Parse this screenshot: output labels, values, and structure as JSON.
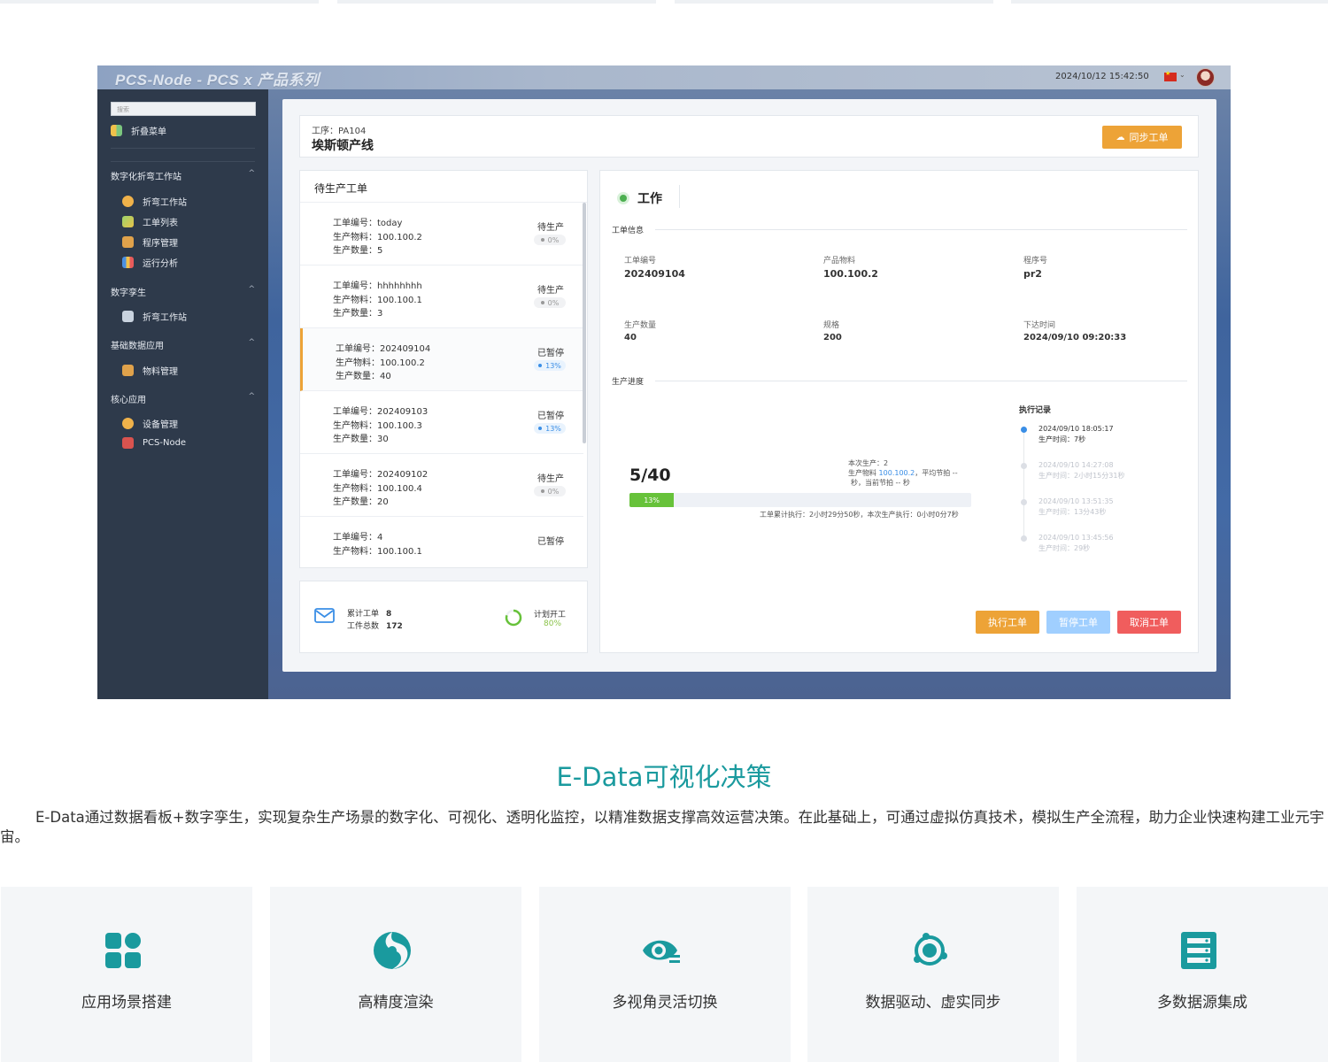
{
  "app": {
    "title": "PCS-Node - PCS x 产品系列",
    "datetime": "2024/10/12 15:42:50",
    "sidebar": {
      "search_placeholder": "搜索",
      "collapse_label": "折叠菜单",
      "groups": [
        {
          "label": "数字化折弯工作站",
          "items": [
            "折弯工作站",
            "工单列表",
            "程序管理",
            "运行分析"
          ]
        },
        {
          "label": "数字孪生",
          "items": [
            "折弯工作站"
          ]
        },
        {
          "label": "基础数据应用",
          "items": [
            "物料管理"
          ]
        },
        {
          "label": "核心应用",
          "items": [
            "设备管理",
            "PCS-Node"
          ]
        }
      ]
    },
    "header": {
      "process_label": "工序：PA104",
      "line_name": "埃斯顿产线",
      "sync_button": "同步工单"
    },
    "work_orders": {
      "title": "待生产工单",
      "items": [
        {
          "no": "工单编号：today",
          "material": "生产物料：100.100.2",
          "qty": "生产数量：5",
          "status": "待生产",
          "pct": "0%"
        },
        {
          "no": "工单编号：hhhhhhhh",
          "material": "生产物料：100.100.1",
          "qty": "生产数量：3",
          "status": "待生产",
          "pct": "0%"
        },
        {
          "no": "工单编号：202409104",
          "material": "生产物料：100.100.2",
          "qty": "生产数量：40",
          "status": "已暂停",
          "pct": "13%"
        },
        {
          "no": "工单编号：202409103",
          "material": "生产物料：100.100.3",
          "qty": "生产数量：30",
          "status": "已暂停",
          "pct": "13%"
        },
        {
          "no": "工单编号：202409102",
          "material": "生产物料：100.100.4",
          "qty": "生产数量：20",
          "status": "待生产",
          "pct": "0%"
        },
        {
          "no": "工单编号：4",
          "material": "生产物料：100.100.1",
          "qty": "",
          "status": "已暂停",
          "pct": ""
        }
      ]
    },
    "stats": {
      "total_orders_label": "累计工单",
      "total_orders": "8",
      "total_parts_label": "工件总数",
      "total_parts": "172",
      "plan_label": "计划开工",
      "plan_pct": "80%",
      "plan_fraction": 0.8
    },
    "detail": {
      "status": "工作",
      "info_label": "工单信息",
      "fields": {
        "order_no_label": "工单编号",
        "order_no": "202409104",
        "material_label": "产品物料",
        "material": "100.100.2",
        "program_label": "程序号",
        "program": "pr2",
        "qty_label": "生产数量",
        "qty": "40",
        "spec_label": "规格",
        "spec": "200",
        "issued_label": "下达时间",
        "issued": "2024/09/10 09:20:33"
      },
      "progress_label": "生产进度",
      "progress_text": "5/40",
      "progress_pct": "13%",
      "progress_fraction": 0.13,
      "note_line1": "本次生产：2",
      "note_line2_a": "生产物料 ",
      "note_line2_b": "100.100.2",
      "note_line2_c": "，平均节拍 --",
      "note_line3": "秒，当前节拍 -- 秒",
      "cumulative": "工单累计执行：2小时29分50秒，本次生产执行：0小时0分7秒",
      "exec_title": "执行记录",
      "exec_records": [
        {
          "time": "2024/09/10 18:05:17",
          "dur": "生产时间：7秒"
        },
        {
          "time": "2024/09/10 14:27:08",
          "dur": "生产时间：2小时15分31秒"
        },
        {
          "time": "2024/09/10 13:51:35",
          "dur": "生产时间：13分43秒"
        },
        {
          "time": "2024/09/10 13:45:56",
          "dur": "生产时间：29秒"
        }
      ],
      "buttons": {
        "execute": "执行工单",
        "pause": "暂停工单",
        "cancel": "取消工单"
      }
    }
  },
  "section": {
    "title": "E-Data可视化决策",
    "description": "E-Data通过数据看板+数字孪生，实现复杂生产场景的数字化、可视化、透明化监控，以精准数据支撑高效运营决策。在此基础上，可通过虚拟仿真技术，模拟生产全流程，助力企业快速构建工业元宇宙。",
    "features": [
      {
        "label": "应用场景搭建",
        "icon": "grid-icon"
      },
      {
        "label": "高精度渲染",
        "icon": "render-icon"
      },
      {
        "label": "多视角灵活切换",
        "icon": "eye-icon"
      },
      {
        "label": "数据驱动、虚实同步",
        "icon": "sync-orbit-icon"
      },
      {
        "label": "多数据源集成",
        "icon": "database-icon"
      }
    ]
  },
  "colors": {
    "accent_teal": "#1a9a9e",
    "orange": "#eda337",
    "green": "#67c23a",
    "blue": "#3a8ee6",
    "red": "#f05d5d",
    "light_blue": "#a0cfff"
  }
}
